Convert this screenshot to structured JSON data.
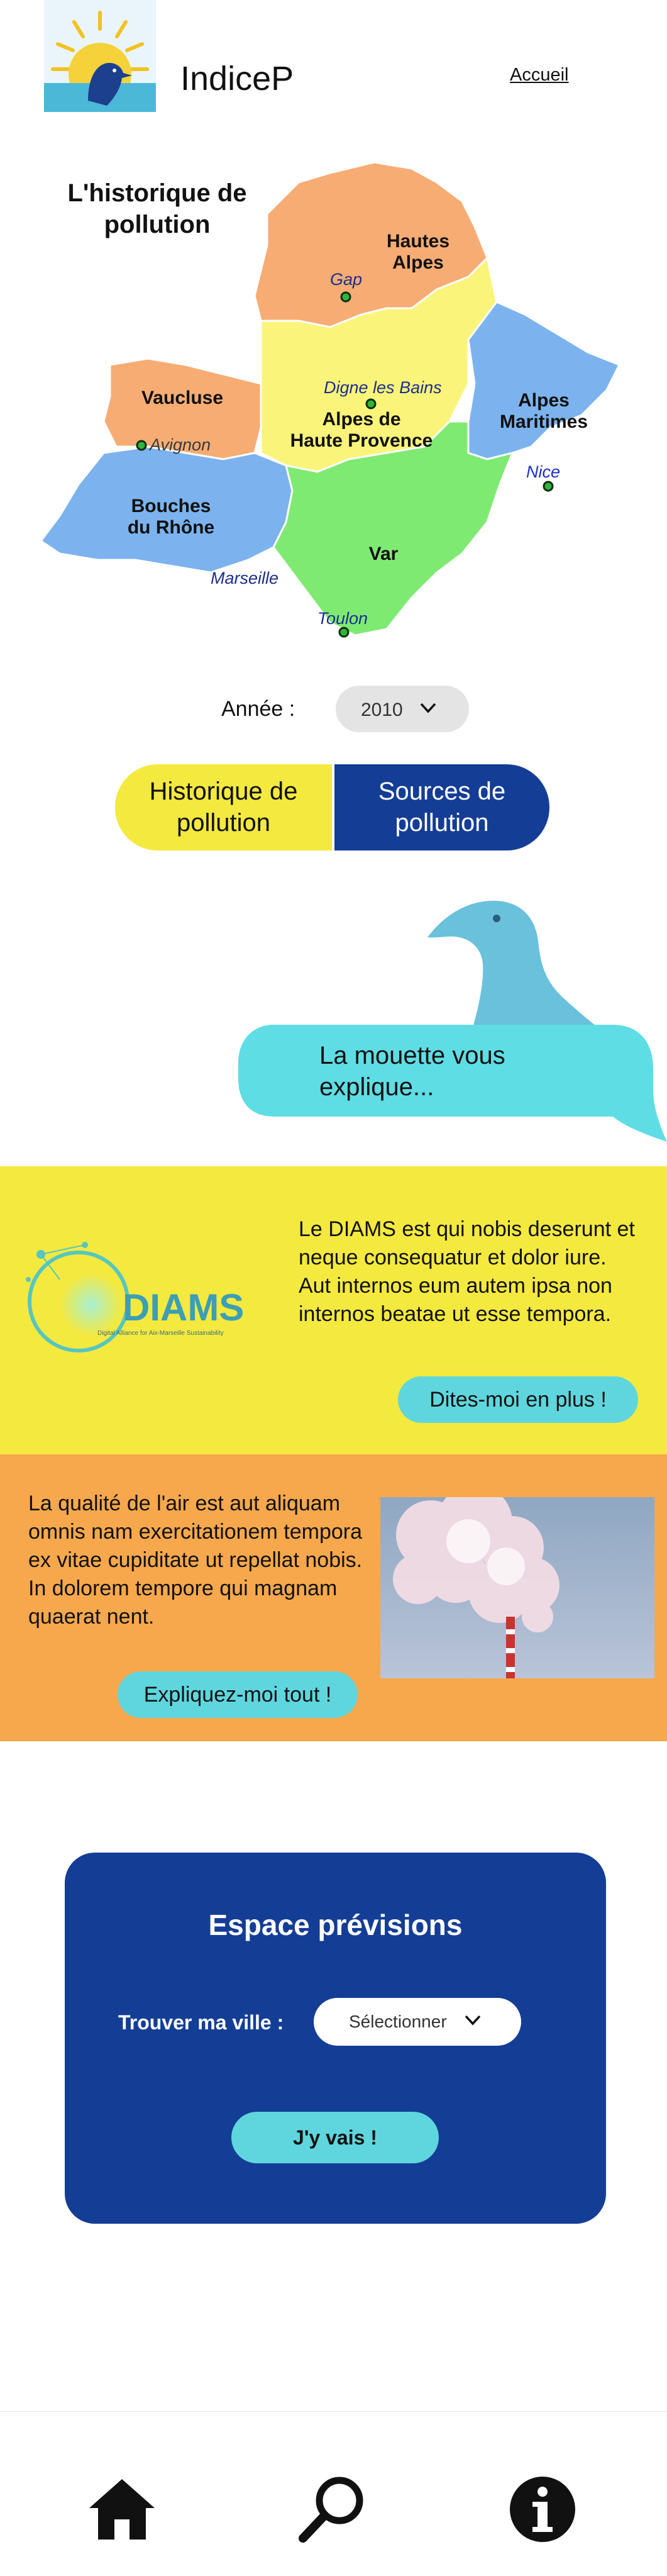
{
  "header": {
    "app_title": "IndiceP",
    "nav_home": "Accueil"
  },
  "map": {
    "title": "L'historique de pollution",
    "departments": {
      "hautes_alpes": [
        "Hautes",
        "Alpes"
      ],
      "vaucluse": [
        "Vaucluse"
      ],
      "alpes_haute_provence": [
        "Alpes de",
        "Haute Provence"
      ],
      "alpes_maritimes": [
        "Alpes",
        "Maritimes"
      ],
      "bouches_du_rhone": [
        "Bouches",
        "du Rhône"
      ],
      "var": [
        "Var"
      ]
    },
    "cities": {
      "gap": "Gap",
      "digne": "Digne les Bains",
      "avignon": "Avignon",
      "nice": "Nice",
      "marseille": "Marseille",
      "toulon": "Toulon"
    },
    "colors": {
      "orange": "#f7ac74",
      "yellow": "#fbf47a",
      "blue": "#7cb3ee",
      "green": "#7fea72"
    }
  },
  "year_selector": {
    "label": "Année :",
    "value": "2010",
    "chevron_icon": "chevron-down-icon"
  },
  "toggle": {
    "history_label": "Historique de pollution",
    "sources_label": "Sources de pollution"
  },
  "mascot": {
    "bubble_text": "La mouette vous explique..."
  },
  "diams": {
    "logo_text": "DIAMS",
    "logo_subtitle": "Digital Alliance for Aix-Marseille Sustainability",
    "text": "Le DIAMS est qui nobis deserunt et neque consequatur et dolor iure. Aut internos eum autem ipsa non internos beatae ut esse tempora.",
    "button_label": "Dites-moi en plus !"
  },
  "air_quality": {
    "text": "La qualité de l'air est aut aliquam omnis nam exercitationem tempora ex vitae cupiditate ut repellat nobis. In dolorem tempore qui magnam quaerat nent.",
    "button_label": "Expliquez-moi tout !"
  },
  "forecast": {
    "title": "Espace prévisions",
    "city_label": "Trouver ma ville :",
    "city_select_value": "Sélectionner",
    "go_button": "J'y vais !"
  },
  "bottom_nav": {
    "items": [
      "home-icon",
      "search-icon",
      "info-icon"
    ]
  },
  "colors": {
    "yellow": "#f4e93f",
    "navy": "#143d96",
    "cyan": "#5fd6dd",
    "orange": "#f8a84c"
  }
}
